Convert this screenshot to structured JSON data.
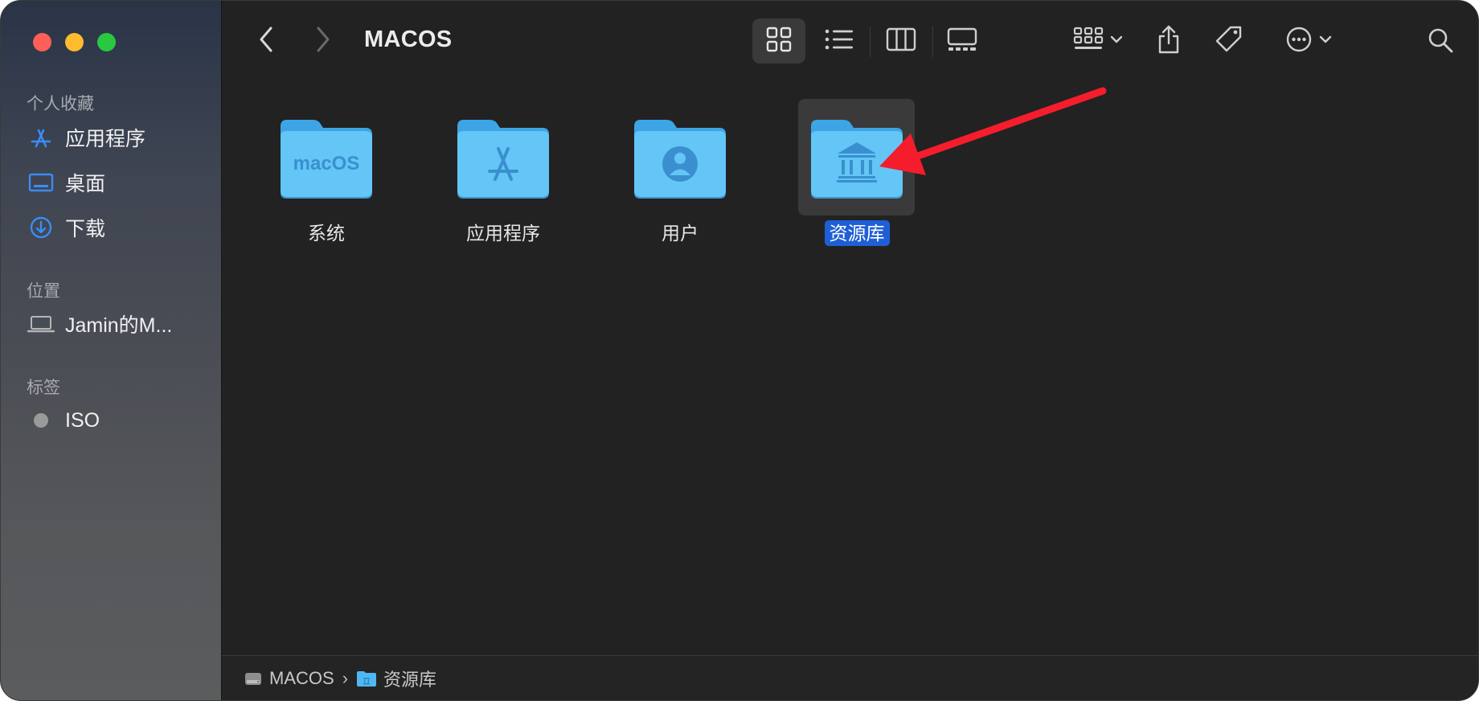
{
  "window": {
    "title": "MACOS"
  },
  "sidebar": {
    "favorites_header": "个人收藏",
    "favorites": [
      {
        "label": "应用程序",
        "icon": "app-store-icon"
      },
      {
        "label": "桌面",
        "icon": "desktop-icon"
      },
      {
        "label": "下载",
        "icon": "download-icon"
      }
    ],
    "locations_header": "位置",
    "locations": [
      {
        "label": "Jamin的M...",
        "icon": "laptop-icon"
      }
    ],
    "tags_header": "标签",
    "tags": [
      {
        "label": "ISO",
        "color": "#9a9a9a"
      }
    ]
  },
  "content": {
    "items": [
      {
        "label": "系统",
        "badge": "macOS"
      },
      {
        "label": "应用程序",
        "badge": "app-store-icon"
      },
      {
        "label": "用户",
        "badge": "user-icon"
      },
      {
        "label": "资源库",
        "badge": "library-icon",
        "selected": true
      }
    ]
  },
  "pathbar": {
    "segments": [
      {
        "label": "MACOS",
        "icon": "disk-icon"
      },
      {
        "label": "资源库",
        "icon": "folder-icon"
      }
    ]
  },
  "colors": {
    "accent": "#1f5fd6",
    "folder": "#5ec4f5",
    "arrow": "#f51d2c"
  }
}
